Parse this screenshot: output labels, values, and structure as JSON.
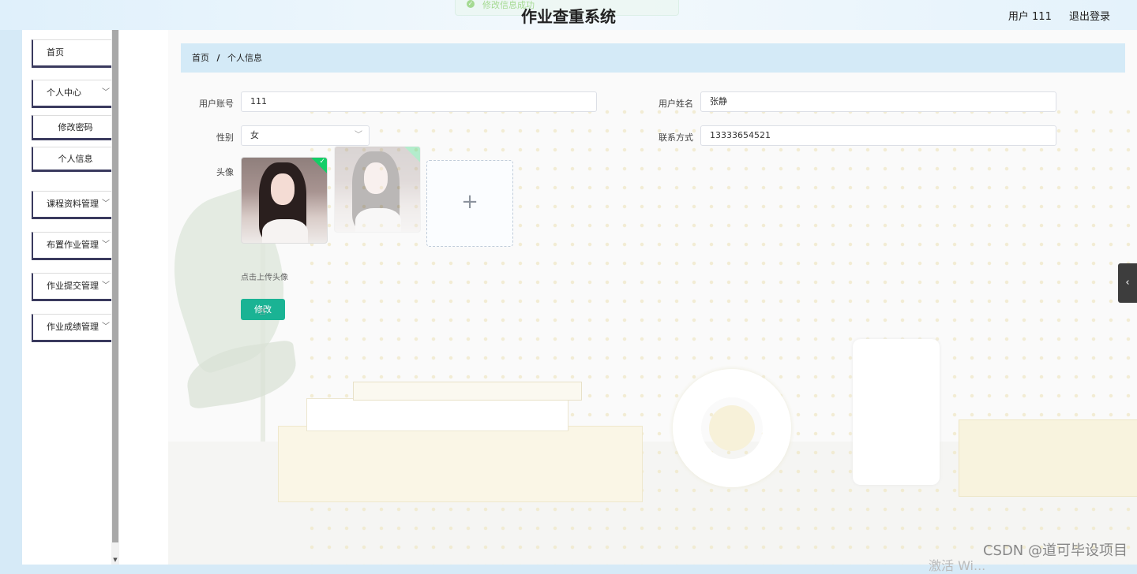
{
  "header": {
    "toast": "修改信息成功",
    "title": "作业查重系统",
    "user_label": "用户 111",
    "logout": "退出登录"
  },
  "sidebar": {
    "items": [
      {
        "label": "首页"
      },
      {
        "label": "个人中心",
        "children": [
          {
            "label": "修改密码"
          },
          {
            "label": "个人信息"
          }
        ]
      },
      {
        "label": "课程资料管理"
      },
      {
        "label": "布置作业管理"
      },
      {
        "label": "作业提交管理"
      },
      {
        "label": "作业成绩管理"
      }
    ]
  },
  "breadcrumb": {
    "home": "首页",
    "separator": "/",
    "current": "个人信息"
  },
  "form": {
    "account_label": "用户账号",
    "account_value": "111",
    "name_label": "用户姓名",
    "name_value": "张静",
    "gender_label": "性别",
    "gender_value": "女",
    "contact_label": "联系方式",
    "contact_value": "13333654521",
    "avatar_label": "头像",
    "upload_plus": "+",
    "upload_hint": "点击上传头像",
    "submit_label": "修改"
  },
  "icons": {
    "chevron": "chevron-down-icon",
    "toggle": "chevron-left-icon"
  },
  "watermark": "CSDN @道可毕设项目",
  "activate_text": "激活 Wi..."
}
